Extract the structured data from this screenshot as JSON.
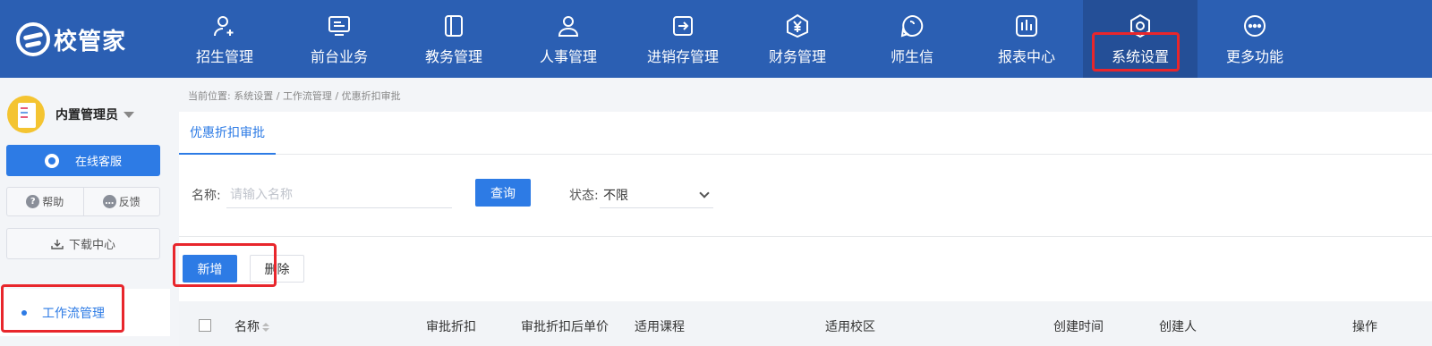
{
  "app": {
    "logo_text": "校管家"
  },
  "nav": {
    "items": [
      {
        "label": "招生管理",
        "icon": "person-plus-icon"
      },
      {
        "label": "前台业务",
        "icon": "monitor-icon"
      },
      {
        "label": "教务管理",
        "icon": "book-icon"
      },
      {
        "label": "人事管理",
        "icon": "person-icon"
      },
      {
        "label": "进销存管理",
        "icon": "arrow-box-icon"
      },
      {
        "label": "财务管理",
        "icon": "yen-icon"
      },
      {
        "label": "师生信",
        "icon": "chat-bubble-icon"
      },
      {
        "label": "报表中心",
        "icon": "bar-chart-icon"
      },
      {
        "label": "系统设置",
        "icon": "settings-icon",
        "active": true
      },
      {
        "label": "更多功能",
        "icon": "more-icon"
      }
    ]
  },
  "sidebar": {
    "user_name": "内置管理员",
    "online_service": "在线客服",
    "help": "帮助",
    "feedback": "反馈",
    "download_center": "下载中心",
    "menu_item": "工作流管理"
  },
  "main": {
    "breadcrumb": {
      "prefix": "当前位置:",
      "items": [
        "系统设置",
        "工作流管理",
        "优惠折扣审批"
      ],
      "separator": "/"
    },
    "tab": "优惠折扣审批",
    "filter": {
      "name_label": "名称:",
      "name_placeholder": "请输入名称",
      "query_button": "查询",
      "status_label": "状态:",
      "status_value": "不限"
    },
    "actions": {
      "add": "新增",
      "delete": "删除"
    },
    "table": {
      "columns": [
        "名称",
        "审批折扣",
        "审批折扣后单价",
        "适用课程",
        "适用校区",
        "创建时间",
        "创建人",
        "操作"
      ]
    }
  },
  "colors": {
    "topbar": "#2b5fb3",
    "primary": "#2d7be5",
    "highlight": "#e8262c"
  }
}
